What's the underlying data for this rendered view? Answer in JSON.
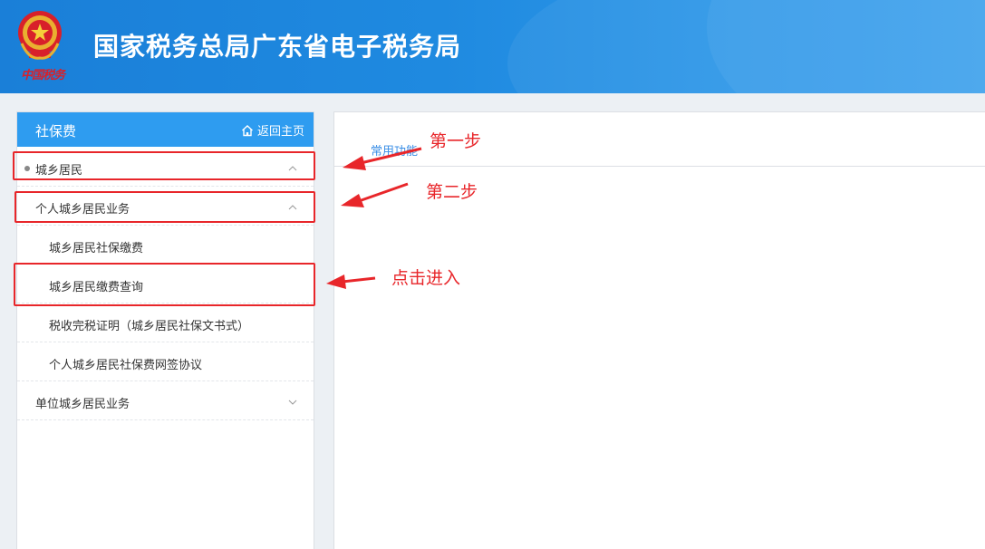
{
  "header": {
    "emblem_text": "中国税务",
    "title": "国家税务总局广东省电子税务局"
  },
  "sidebar": {
    "title": "社保费",
    "home_label": "返回主页",
    "items": [
      {
        "label": "城乡居民"
      },
      {
        "label": "个人城乡居民业务"
      },
      {
        "label": "城乡居民社保缴费"
      },
      {
        "label": "城乡居民缴费查询"
      },
      {
        "label": "税收完税证明（城乡居民社保文书式）"
      },
      {
        "label": "个人城乡居民社保费网签协议"
      },
      {
        "label": "单位城乡居民业务"
      }
    ]
  },
  "main": {
    "tab_label": "常用功能"
  },
  "annotations": {
    "step1": "第一步",
    "step2": "第二步",
    "step3": "点击进入"
  },
  "colors": {
    "header": "#1f8ae0",
    "sidebar_head": "#2e9cf0",
    "annotation": "#e8262a",
    "link": "#3a8ee6"
  }
}
